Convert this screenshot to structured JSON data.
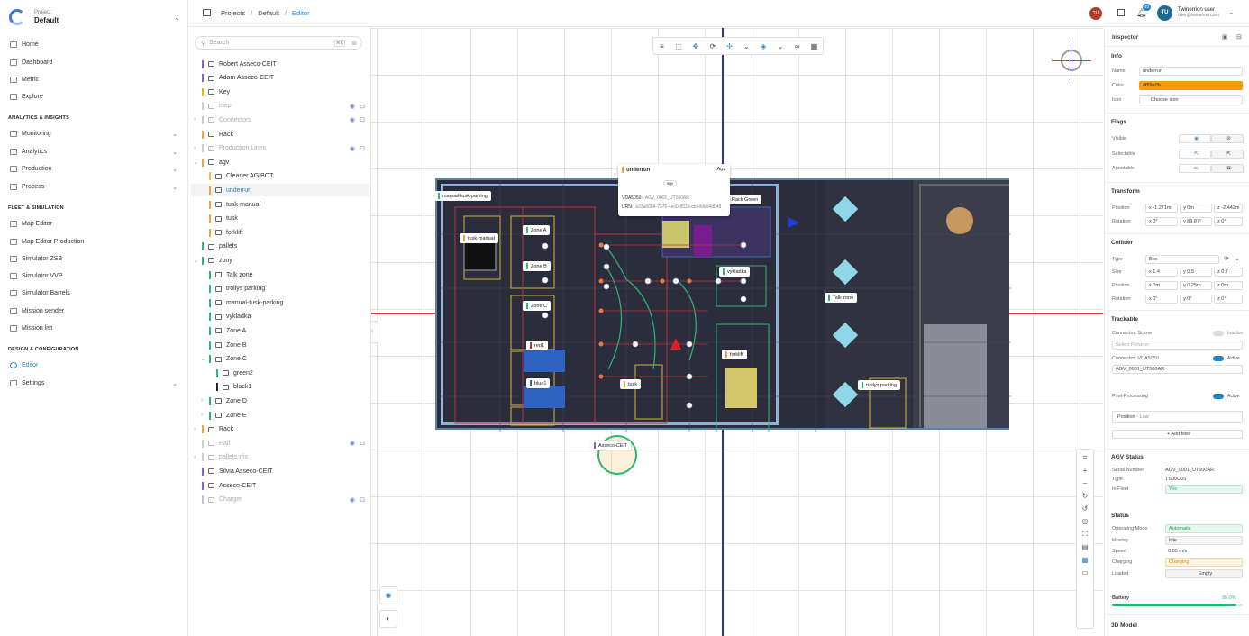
{
  "project": {
    "label": "Project",
    "name": "Default"
  },
  "nav": {
    "home": "Home",
    "dashboard": "Dashboard",
    "metric": "Metric",
    "explore": "Explore",
    "section_analytics": "ANALYTICS & INSIGHTS",
    "monitoring": "Monitoring",
    "analytics": "Analytics",
    "production": "Production",
    "process": "Process",
    "section_fleet": "FLEET & SIMULATION",
    "map_editor": "Map Editor",
    "map_editor_production": "Map Editor Production",
    "simulator_zsb": "Simulator ZSB",
    "simulator_vvp": "Simulator VVP",
    "simulator_barrels": "Simulator Barrels",
    "mission_sender": "Mission sender",
    "mission_list": "Mission list",
    "section_design": "DESIGN & CONFIGURATION",
    "editor": "Editor",
    "settings": "Settings"
  },
  "breadcrumb": {
    "projects": "Projects",
    "sep1": "/",
    "default": "Default",
    "sep2": "/",
    "editor": "Editor"
  },
  "user": {
    "initials": "TU",
    "name": "Twinerrion user",
    "email": "user@twinerion.com",
    "notif_count": "40",
    "avatar_small": "TU"
  },
  "search": {
    "placeholder": "Search",
    "shortcut": "⌘K"
  },
  "tree": [
    {
      "label": "Robert Asseco-CEIT",
      "color": "#8e5bd6"
    },
    {
      "label": "Adam Asseco-CEIT",
      "color": "#8e5bd6"
    },
    {
      "label": "Key",
      "color": "#e6b800"
    },
    {
      "label": "mep",
      "color": "#b8d8c0"
    },
    {
      "label": "Connectors",
      "color": "#b8d8c0"
    },
    {
      "label": "Rack",
      "color": "#f0a040"
    },
    {
      "label": "Production Lines",
      "color": "#b8d8c0"
    },
    {
      "label": "agv",
      "color": "#f0a040"
    },
    {
      "label": "Cleaner AGIBOT",
      "color": "#f0c040"
    },
    {
      "label": "underrun",
      "color": "#f0a040"
    },
    {
      "label": "tusk-manual",
      "color": "#f0a040"
    },
    {
      "label": "tusk",
      "color": "#f0a040"
    },
    {
      "label": "forklift",
      "color": "#f0a040"
    },
    {
      "label": "pallets",
      "color": "#2bb673"
    },
    {
      "label": "zony",
      "color": "#2bb673"
    },
    {
      "label": "Talk zone",
      "color": "#2bb673"
    },
    {
      "label": "trollys parking",
      "color": "#2bb673"
    },
    {
      "label": "manual-tusk-parking",
      "color": "#2bb673"
    },
    {
      "label": "vykladka",
      "color": "#2bb673"
    },
    {
      "label": "Zone A",
      "color": "#2bb673"
    },
    {
      "label": "Zone B",
      "color": "#2bb673"
    },
    {
      "label": "Zone C",
      "color": "#2bb673"
    },
    {
      "label": "green2",
      "color": "#2bb673"
    },
    {
      "label": "black1",
      "color": "#222222"
    },
    {
      "label": "Zone D",
      "color": "#2bb673"
    },
    {
      "label": "Zone E",
      "color": "#2bb673"
    },
    {
      "label": "Rack",
      "color": "#f0a040"
    },
    {
      "label": "Hall",
      "color": "#b8d8c0"
    },
    {
      "label": "pallets-rfis",
      "color": "#b8d8c0"
    },
    {
      "label": "Silvia Asseco-CEIT",
      "color": "#8e5bd6"
    },
    {
      "label": "Asseco-CEIT",
      "color": "#8e5bd6"
    },
    {
      "label": "Charger",
      "color": "#c9b6e8"
    }
  ],
  "inspector": {
    "title": "Inspector",
    "info": {
      "header": "Info",
      "name_label": "Name",
      "name_value": "underrun",
      "color_label": "Color",
      "color_value": "#f59e0b",
      "icon_label": "Icon",
      "icon_value": "Choose icon"
    },
    "flags": {
      "header": "Flags",
      "visible": "Visible",
      "selectable": "Selectable",
      "annotable": "Annotable"
    },
    "transform": {
      "header": "Transform",
      "position_label": "Position",
      "px": "x -1.271m",
      "py": "y 0m",
      "pz": "z -2.442m",
      "rotation_label": "Rotation",
      "rx": "x 0°",
      "ry": "y 89.87°",
      "rz": "z 0°"
    },
    "collider": {
      "header": "Collider",
      "type_label": "Type",
      "type_value": "Box",
      "size_label": "Size",
      "sx": "x 1.4",
      "sy": "y 0.5",
      "sz": "z 0.7",
      "position_label": "Position",
      "cpx": "x 0m",
      "cpy": "y 0.25m",
      "cpz": "z 0m",
      "rotation_label": "Rotation",
      "crx": "x 0°",
      "cry": "y 0°",
      "crz": "z 0°"
    },
    "trackable": {
      "header": "Trackable",
      "connector_scene": "Connector: Scene",
      "inactive": "Inactive",
      "select_provider": "Select Provider",
      "connector_vda": "Connector: VDA5050",
      "active": "Active",
      "agv_id": "AGV_0001_UT500AR",
      "post_processing": "Post-Processing",
      "pp_active": "Active",
      "position_filter": "Position",
      "filter_level": "Low",
      "add_filter": "+ Add filter"
    },
    "agv_status": {
      "header": "AGV Status",
      "serial_label": "Serial Number",
      "serial_value": "AGV_0001_UT500AR",
      "type_label": "Type",
      "type_value": "TS00U05",
      "fleet_label": "In Fleet",
      "fleet_value": "Yes"
    },
    "status": {
      "header": "Status",
      "mode_label": "Operating Mode",
      "mode_value": "Automatic",
      "moving_label": "Moving",
      "moving_value": "Idle",
      "speed_label": "Speed",
      "speed_value": "0.00 m/s",
      "charging_label": "Charging",
      "charging_value": "Charging",
      "loaded_label": "Loaded",
      "loaded_value": "Empty",
      "battery_label": "Battery",
      "battery_value": "95.0%",
      "battery_level": 0.95
    },
    "model": {
      "header": "3D Model"
    }
  },
  "map_labels": {
    "manual_tusk_parking": "manual-tusk-parking",
    "tusk_manual": "tusk-manual",
    "zone_a": "Zone A",
    "zone_b": "Zone B",
    "zone_c": "Zone C",
    "red1": "red1",
    "blue1": "blue1",
    "tusk": "tusk",
    "vykladka": "vykladka",
    "forklift": "forklift",
    "talk_zone": "Talk zone",
    "trollys_parking": "trollys parking",
    "rack_green": "Rack Green",
    "asseco": "Asseco-CEIT",
    "underrun": "underrun",
    "agv_tag": "Agv",
    "agv_small": "agv",
    "vda": "VDA5050:",
    "vda_val": "AGV_0001_UT500AR",
    "urn": "URN:",
    "urn_val": "a33a6684-7376-4ec0-851d-cb54ddb4d048"
  }
}
